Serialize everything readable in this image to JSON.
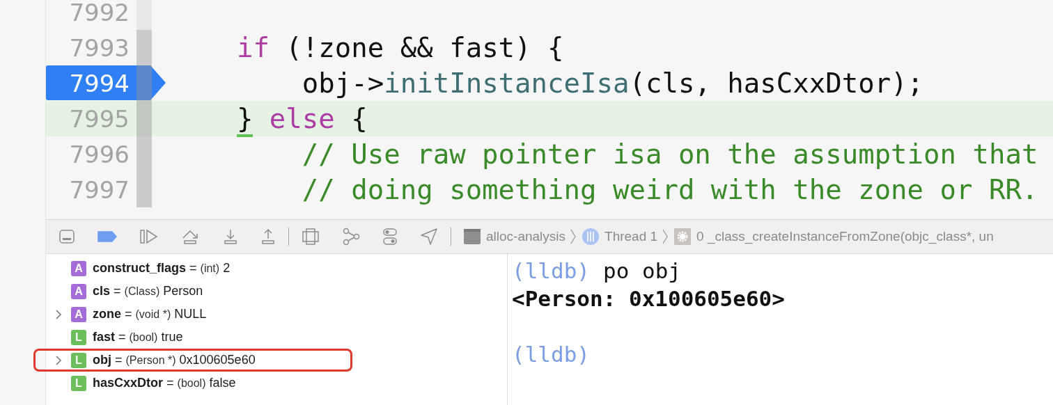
{
  "editor": {
    "lines": [
      {
        "number": "7992",
        "breakpoint": false,
        "current": false
      },
      {
        "number": "7993",
        "breakpoint": false,
        "current": false,
        "tokens": [
          {
            "kind": "keyword",
            "text": "    if"
          },
          {
            "kind": "plain",
            "text": " (!zone && fast) {"
          }
        ]
      },
      {
        "number": "7994",
        "breakpoint": true,
        "current": false,
        "tokens": [
          {
            "kind": "plain",
            "text": "        obj->"
          },
          {
            "kind": "function",
            "text": "initInstanceIsa"
          },
          {
            "kind": "plain",
            "text": "(cls, hasCxxDtor);"
          }
        ]
      },
      {
        "number": "7995",
        "breakpoint": false,
        "current": true,
        "tokens": [
          {
            "kind": "indent-brace",
            "text": "}"
          },
          {
            "kind": "keyword",
            "text": " else"
          },
          {
            "kind": "plain",
            "text": " {"
          }
        ]
      },
      {
        "number": "7996",
        "breakpoint": false,
        "current": false,
        "tokens": [
          {
            "kind": "comment",
            "text": "        // Use raw pointer isa on the assumption that"
          }
        ]
      },
      {
        "number": "7997",
        "breakpoint": false,
        "current": false,
        "tokens": [
          {
            "kind": "comment",
            "text": "        // doing something weird with the zone or RR."
          }
        ]
      }
    ]
  },
  "debug_bar": {
    "breakpoints_active": true,
    "breadcrumbs": [
      {
        "label": "alloc-analysis"
      },
      {
        "label": "Thread 1"
      },
      {
        "label": "0 _class_createInstanceFromZone(objc_class*, un"
      }
    ]
  },
  "variables": [
    {
      "kind": "argument",
      "badge": "A",
      "name": "construct_flags",
      "equals": "=",
      "type": "(int)",
      "value": "2",
      "expandable": false,
      "highlighted": false
    },
    {
      "kind": "argument",
      "badge": "A",
      "name": "cls",
      "equals": "=",
      "type": "(Class)",
      "value": "Person",
      "expandable": false,
      "highlighted": false
    },
    {
      "kind": "argument",
      "badge": "A",
      "name": "zone",
      "equals": "=",
      "type": "(void *)",
      "value": "NULL",
      "expandable": true,
      "highlighted": false
    },
    {
      "kind": "local",
      "badge": "L",
      "name": "fast",
      "equals": "=",
      "type": "(bool)",
      "value": "true",
      "expandable": false,
      "highlighted": false
    },
    {
      "kind": "local",
      "badge": "L",
      "name": "obj",
      "equals": "=",
      "type": "(Person *)",
      "value": "0x100605e60",
      "expandable": true,
      "highlighted": true
    },
    {
      "kind": "local",
      "badge": "L",
      "name": "hasCxxDtor",
      "equals": "=",
      "type": "(bool)",
      "value": "false",
      "expandable": false,
      "highlighted": false
    }
  ],
  "console": [
    {
      "kind": "prompt",
      "prompt": "(lldb)",
      "command": "po obj"
    },
    {
      "kind": "output",
      "text": "<Person: 0x100605e60>"
    },
    {
      "kind": "blank"
    },
    {
      "kind": "prompt",
      "prompt": "(lldb)"
    }
  ]
}
